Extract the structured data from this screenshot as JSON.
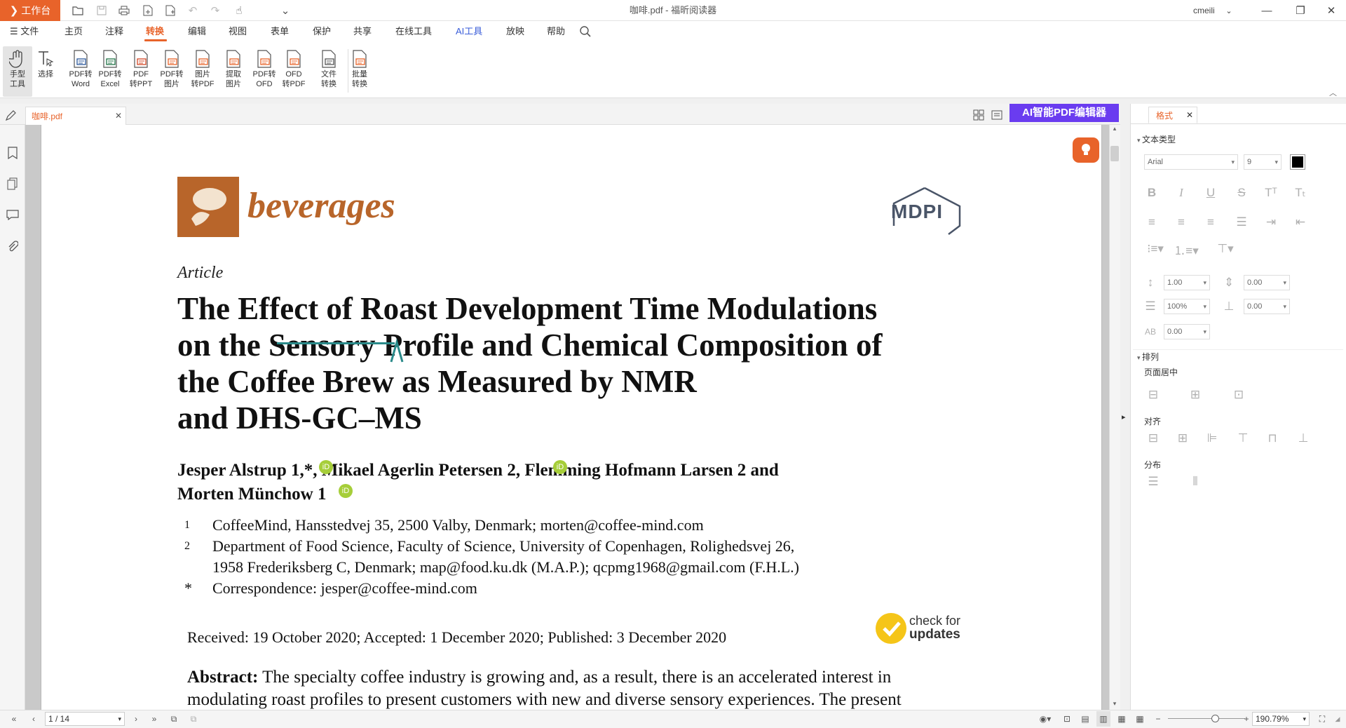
{
  "titlebar": {
    "workbench_label": "工作台",
    "window_title": "咖啡.pdf - 福昕阅读器",
    "user": "cmeili"
  },
  "menu": {
    "items": [
      "文件",
      "主页",
      "注释",
      "转换",
      "编辑",
      "视图",
      "表单",
      "保护",
      "共享",
      "在线工具",
      "AI工具",
      "放映",
      "帮助"
    ],
    "active": "转换"
  },
  "ribbon": {
    "tools": [
      {
        "label": "手型\n工具",
        "icon": "hand-icon"
      },
      {
        "label": "选择",
        "icon": "select-text-icon"
      },
      {
        "label": "PDF转\nWord",
        "icon": "pdf-to-word-icon"
      },
      {
        "label": "PDF转\nExcel",
        "icon": "pdf-to-excel-icon"
      },
      {
        "label": "PDF\n转PPT",
        "icon": "pdf-to-ppt-icon"
      },
      {
        "label": "PDF转\n图片",
        "icon": "pdf-to-image-icon"
      },
      {
        "label": "图片\n转PDF",
        "icon": "image-to-pdf-icon"
      },
      {
        "label": "提取\n图片",
        "icon": "extract-image-icon"
      },
      {
        "label": "PDF转\nOFD",
        "icon": "pdf-to-ofd-icon"
      },
      {
        "label": "OFD\n转PDF",
        "icon": "ofd-to-pdf-icon"
      },
      {
        "label": "文件\n转换",
        "icon": "file-convert-icon"
      },
      {
        "label": "批量\n转换",
        "icon": "batch-convert-icon"
      }
    ]
  },
  "tabs": {
    "document_tab": "咖啡.pdf",
    "ai_editor": "AI智能PDF编辑器"
  },
  "document": {
    "journal": "beverages",
    "publisher": "MDPI",
    "article_type": "Article",
    "title_lines": [
      "The Effect of Roast Development Time Modulations",
      "on the Sensory Profile and Chemical Composition of",
      "the Coffee Brew as Measured by NMR",
      "and DHS-GC–MS"
    ],
    "authors_line1": "Jesper Alstrup 1,*, Mikael Agerlin Petersen 2, Flemming Hofmann Larsen 2 and",
    "authors_line2": "Morten Münchow 1",
    "affiliations": [
      {
        "mark": "1",
        "text": "CoffeeMind, Hansstedvej 35, 2500 Valby, Denmark; morten@coffee-mind.com"
      },
      {
        "mark": "2",
        "text": "Department of Food Science, Faculty of Science, University of Copenhagen, Rolighedsvej 26,"
      },
      {
        "mark": "",
        "text": "1958 Frederiksberg C, Denmark; map@food.ku.dk (M.A.P.); qcpmg1968@gmail.com (F.H.L.)"
      },
      {
        "mark": "*",
        "text": "Correspondence: jesper@coffee-mind.com"
      }
    ],
    "dates": "Received: 19 October 2020; Accepted: 1 December 2020; Published: 3 December 2020",
    "check_line1": "check for",
    "check_line2": "updates",
    "abstract_label": "Abstract:",
    "abstract_line1": " The specialty coffee industry is growing and, as a result, there is an accelerated interest in",
    "abstract_line2": "modulating roast profiles to present customers with new and diverse sensory experiences. The present"
  },
  "format_panel": {
    "tab": "格式",
    "text_type_title": "文本类型",
    "font": "Arial",
    "font_size": "9",
    "font_color": "#000000",
    "line_spacing": "1.00",
    "para_spacing": "0.00",
    "scale": "100%",
    "indent": "0.00",
    "char_spacing": "0.00",
    "arrange_title": "排列",
    "page_center": "页面居中",
    "align": "对齐",
    "distribute": "分布"
  },
  "statusbar": {
    "page": "1 / 14",
    "zoom": "190.79%"
  },
  "colors": {
    "accent": "#e8632a",
    "ai_purple": "#6a3cf0",
    "journal_brown": "#b8652a"
  }
}
